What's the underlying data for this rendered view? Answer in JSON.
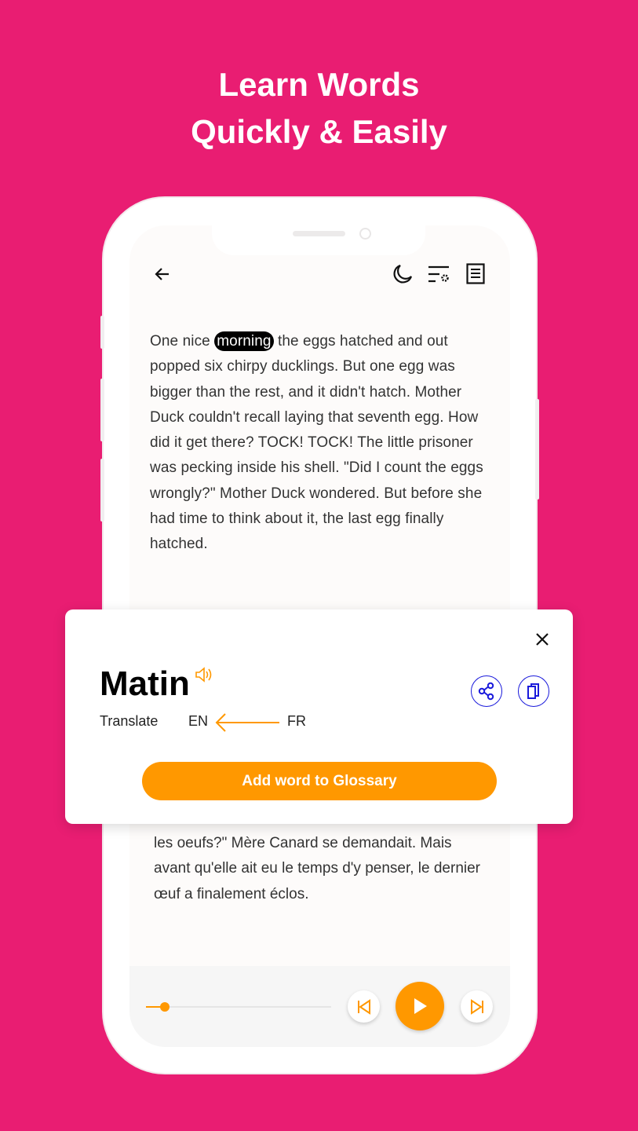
{
  "headline": {
    "line1": "Learn Words",
    "line2": "Quickly & Easily"
  },
  "reader": {
    "text_before": "One nice ",
    "highlighted_word": "morning",
    "text_after": " the eggs hatched and out popped six chirpy ducklings. But one egg was bigger than the rest, and it didn't hatch. Mother Duck couldn't recall laying that seventh egg. How did it get there? TOCK! TOCK! The little prisoner was pecking inside his shell. \"Did I count the eggs wrongly?\" Mother Duck wondered. But before she had time to think about it, the last egg finally hatched.",
    "translation_text": "les oeufs?\" Mère Canard se demandait. Mais avant qu'elle ait eu le temps d'y penser, le dernier œuf a finalement éclos."
  },
  "toolbar": {
    "icons": [
      "back-arrow-icon",
      "moon-icon",
      "text-settings-icon",
      "document-icon"
    ]
  },
  "popup": {
    "word": "Matin",
    "translate_label": "Translate",
    "from_lang": "EN",
    "to_lang": "FR",
    "add_button": "Add word to Glossary"
  },
  "player": {
    "progress_percent": 10
  },
  "colors": {
    "background": "#e91d72",
    "accent": "#ff9800",
    "icon_blue": "#1a1adb"
  }
}
